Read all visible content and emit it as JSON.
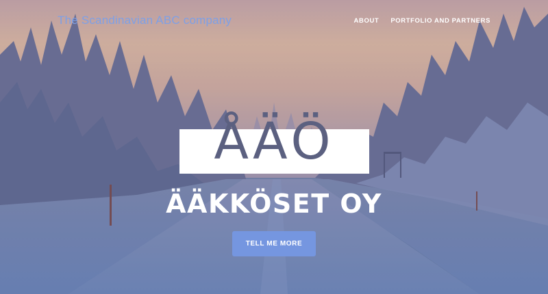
{
  "header": {
    "brand": "The Scandinavian ABC company",
    "nav": [
      {
        "label": "ABOUT"
      },
      {
        "label": "PORTFOLIO AND PARTNERS"
      }
    ]
  },
  "hero": {
    "logo_letters": "ÅÄÖ",
    "company_name": "ÄÄKKÖSET OY",
    "cta_label": "TELL ME MORE"
  },
  "colors": {
    "brand": "#7ea0e6",
    "cta": "#7596e0",
    "logo_band": "#ffffff",
    "logo_letters": "#5b6080"
  },
  "icons": {
    "background": "snowy-forest-road-photo"
  }
}
